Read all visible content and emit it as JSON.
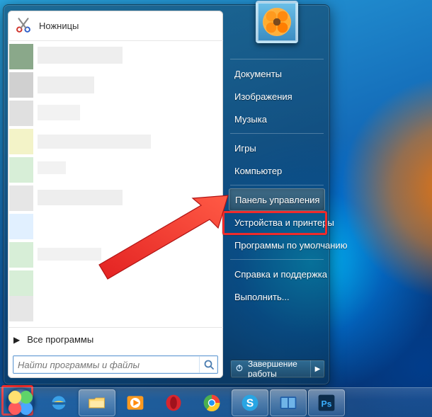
{
  "pinned": {
    "snipping_tool": "Ножницы"
  },
  "all_programs": "Все программы",
  "search": {
    "placeholder": "Найти программы и файлы"
  },
  "right": {
    "items": [
      "Документы",
      "Изображения",
      "Музыка",
      "Игры",
      "Компьютер",
      "Панель управления",
      "Устройства и принтеры",
      "Программы по умолчанию",
      "Справка и поддержка",
      "Выполнить..."
    ]
  },
  "shutdown": {
    "label": "Завершение работы"
  },
  "annotations": {
    "highlight_item_index": 5,
    "red_start_button": true
  }
}
